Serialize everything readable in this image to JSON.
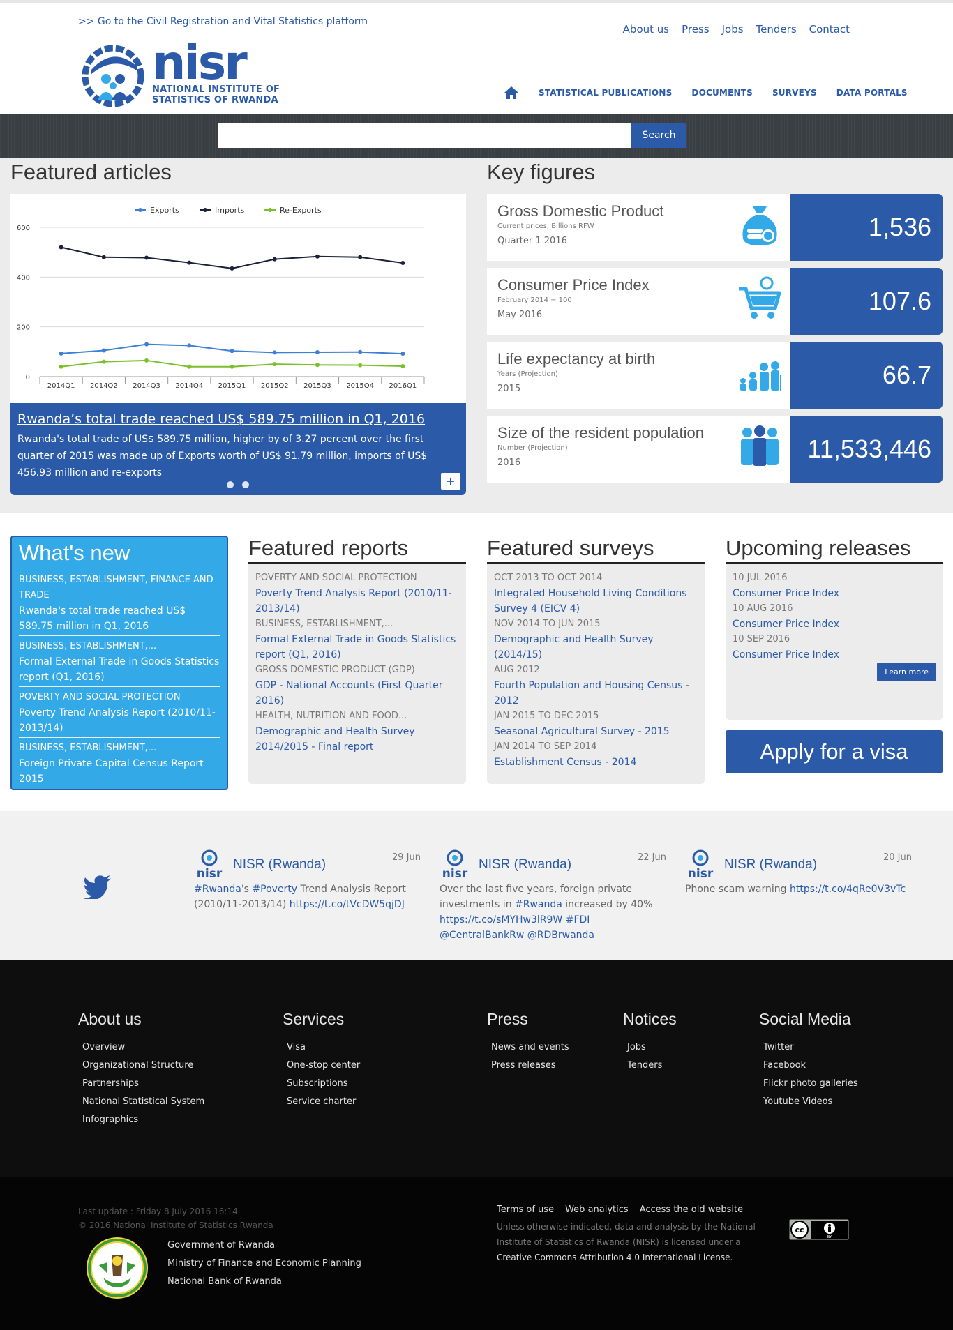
{
  "header": {
    "crvs_link": ">> Go to the Civil Registration and Vital Statistics platform",
    "util_nav": [
      "About us",
      "Press",
      "Jobs",
      "Tenders",
      "Contact"
    ],
    "logo_word": "nisr",
    "logo_sub_line1": "NATIONAL INSTITUTE OF",
    "logo_sub_line2": "STATISTICS OF RWANDA",
    "main_nav": [
      "STATISTICAL PUBLICATIONS",
      "DOCUMENTS",
      "SURVEYS",
      "DATA PORTALS"
    ]
  },
  "search": {
    "placeholder": "",
    "button": "Search"
  },
  "featured_articles": {
    "title": "Featured articles",
    "article_title": "Rwanda’s total trade reached US$ 589.75 million in Q1, 2016",
    "article_body": "Rwanda's total trade of US$ 589.75 million, higher by of 3.27 percent over the first quarter of 2015 was made up of Exports worth of US$ 91.79 million, imports of US$ 456.93 million and re-exports",
    "plus": "+"
  },
  "chart_data": {
    "type": "line",
    "categories": [
      "2014Q1",
      "2014Q2",
      "2014Q3",
      "2014Q4",
      "2015Q1",
      "2015Q2",
      "2015Q3",
      "2015Q4",
      "2016Q1"
    ],
    "series": [
      {
        "name": "Exports",
        "values": [
          93,
          105,
          130,
          125,
          103,
          97,
          98,
          99,
          92
        ],
        "color": "#3d7fd1"
      },
      {
        "name": "Imports",
        "values": [
          520,
          480,
          478,
          458,
          435,
          472,
          483,
          480,
          457
        ],
        "color": "#1a2238"
      },
      {
        "name": "Re-Exports",
        "values": [
          40,
          60,
          65,
          40,
          40,
          50,
          47,
          46,
          42
        ],
        "color": "#7cbf2c"
      }
    ],
    "yticks": [
      0,
      200,
      400,
      600
    ],
    "ylim": [
      0,
      600
    ],
    "legend": "top",
    "grid": true
  },
  "key_figures": {
    "title": "Key figures",
    "items": [
      {
        "name": "Gross Domestic Product",
        "note": "Current prices, Billions RFW",
        "period": "Quarter 1 2016",
        "value": "1,536",
        "icon": "money-bag-icon"
      },
      {
        "name": "Consumer Price Index",
        "note": "February 2014 = 100",
        "period": "May 2016",
        "value": "107.6",
        "icon": "shopping-cart-icon"
      },
      {
        "name": "Life expectancy at birth",
        "note": "Years (Projection)",
        "period": "2015",
        "value": "66.7",
        "icon": "family-ages-icon"
      },
      {
        "name": "Size of the resident population",
        "note": "Number (Projection)",
        "period": "2016",
        "value": "11,533,446",
        "icon": "population-icon"
      }
    ]
  },
  "whats_new": {
    "title": "What's new",
    "items": [
      {
        "category": "BUSINESS, ESTABLISHMENT, FINANCE AND TRADE",
        "link": "Rwanda's total trade reached US$ 589.75 million in Q1, 2016"
      },
      {
        "category": "BUSINESS, ESTABLISHMENT,...",
        "link": "Formal External Trade in Goods Statistics report (Q1, 2016)"
      },
      {
        "category": "POVERTY AND SOCIAL PROTECTION",
        "link": "Poverty Trend Analysis Report (2010/11-2013/14)"
      },
      {
        "category": "BUSINESS, ESTABLISHMENT,...",
        "link": "Foreign Private Capital Census Report 2015"
      }
    ]
  },
  "featured_reports": {
    "title": "Featured reports",
    "items": [
      {
        "category": "POVERTY AND SOCIAL PROTECTION",
        "link": "Poverty Trend Analysis Report (2010/11-2013/14)"
      },
      {
        "category": "BUSINESS, ESTABLISHMENT,...",
        "link": "Formal External Trade in Goods Statistics report (Q1, 2016)"
      },
      {
        "category": "GROSS DOMESTIC PRODUCT (GDP)",
        "link": "GDP - National Accounts (First Quarter 2016)"
      },
      {
        "category": "HEALTH, NUTRITION AND FOOD...",
        "link": "Demographic and Health Survey 2014/2015 - Final report"
      }
    ]
  },
  "featured_surveys": {
    "title": "Featured surveys",
    "items": [
      {
        "category": "OCT 2013 TO OCT 2014",
        "link": "Integrated Household Living Conditions Survey 4 (EICV 4)"
      },
      {
        "category": "NOV 2014 TO JUN 2015",
        "link": "Demographic and Health Survey (2014/15)"
      },
      {
        "category": "AUG 2012",
        "link": "Fourth Population and Housing Census - 2012"
      },
      {
        "category": "JAN 2015 TO DEC 2015",
        "link": "Seasonal Agricultural Survey - 2015"
      },
      {
        "category": "JAN 2014 TO SEP 2014",
        "link": "Establishment Census - 2014"
      }
    ]
  },
  "upcoming_releases": {
    "title": "Upcoming releases",
    "items": [
      {
        "date": "10 JUL 2016",
        "link": "Consumer Price Index"
      },
      {
        "date": "10 AUG 2016",
        "link": "Consumer Price Index"
      },
      {
        "date": "10 SEP 2016",
        "link": "Consumer Price Index"
      }
    ],
    "learn_more": "Learn more",
    "visa_button": "Apply for a visa"
  },
  "tweets": [
    {
      "name": "NISR (Rwanda)",
      "date": "29 Jun",
      "parts": [
        "#Rwanda",
        "'s ",
        "#Poverty",
        " Trend Analysis Report (2010/11-2013/14) ",
        "https://t.co/tVcDW5qjDJ"
      ]
    },
    {
      "name": "NISR (Rwanda)",
      "date": "22 Jun",
      "parts": [
        "Over the last five years, foreign private investments in ",
        "#Rwanda",
        " increased by 40% ",
        "https://t.co/sMYHw3lR9W #FDI @CentralBankRw @RDBrwanda"
      ]
    },
    {
      "name": "NISR (Rwanda)",
      "date": "20 Jun",
      "parts": [
        "Phone scam warning ",
        "https://t.co/4qRe0V3vTc"
      ]
    }
  ],
  "footer": {
    "about": {
      "title": "About us",
      "items": [
        "Overview",
        "Organizational Structure",
        "Partnerships",
        "National Statistical System",
        "Infographics"
      ]
    },
    "services": {
      "title": "Services",
      "items": [
        "Visa",
        "One-stop center",
        "Subscriptions",
        "Service charter"
      ]
    },
    "press": {
      "title": "Press",
      "items": [
        "News and events",
        "Press releases"
      ]
    },
    "notices": {
      "title": "Notices",
      "items": [
        "Jobs",
        "Tenders"
      ]
    },
    "social": {
      "title": "Social Media",
      "items": [
        "Twitter",
        "Facebook",
        "Flickr photo galleries",
        "Youtube Videos"
      ]
    }
  },
  "subfooter": {
    "updated": "Last update : Friday 8 July 2016 16:14",
    "copyright": "© 2016 National Institute of Statistics Rwanda",
    "gov_links": [
      "Government of Rwanda",
      "Ministry of Finance and Economic Planning",
      "National Bank of Rwanda"
    ],
    "links": [
      "Terms of use",
      "Web analytics",
      "Access the old website"
    ],
    "license_text": "Unless otherwise indicated, data and analysis by the National Institute of Statistics of Rwanda (NISR) is licensed under a ",
    "license_link": "Creative Commons Attribution 4.0 International License.",
    "cc_label": "BY"
  },
  "colors": {
    "brand_blue": "#2a5aa8",
    "light_blue": "#34a9e8",
    "footer_bg": "#0e0e0e"
  }
}
